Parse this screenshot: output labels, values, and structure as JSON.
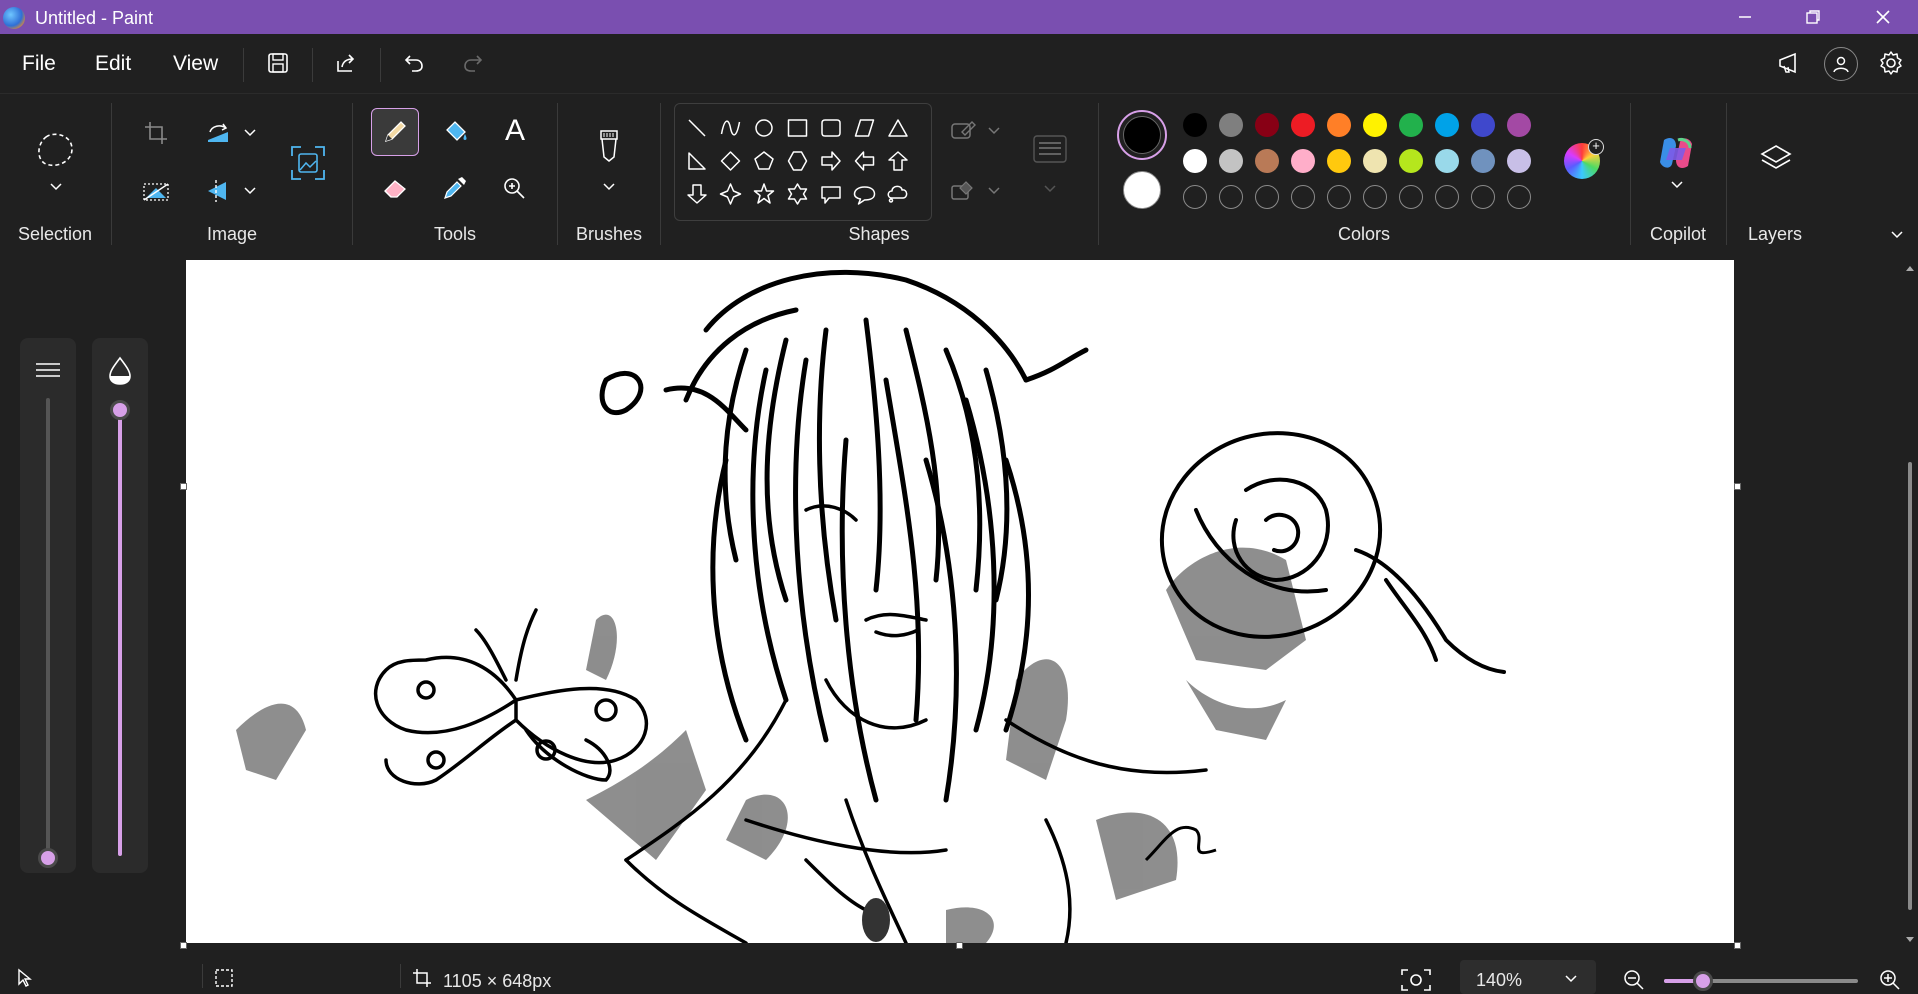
{
  "window": {
    "title": "Untitled - Paint",
    "minimize_glyph": "─",
    "maximize_glyph": "⧉",
    "close_glyph": "✕"
  },
  "menu": {
    "file": "File",
    "edit": "Edit",
    "view": "View"
  },
  "ribbon": {
    "groups": {
      "selection": "Selection",
      "image": "Image",
      "tools": "Tools",
      "brushes": "Brushes",
      "shapes": "Shapes",
      "colors": "Colors",
      "copilot": "Copilot",
      "layers": "Layers"
    },
    "text_tool_glyph": "A",
    "shapes": [
      "line",
      "curve",
      "oval",
      "rectangle",
      "rounded-rectangle",
      "polygon",
      "triangle",
      "right-triangle",
      "diamond",
      "pentagon",
      "hexagon",
      "right-arrow",
      "left-arrow",
      "up-arrow",
      "down-arrow",
      "four-point-star",
      "five-point-star",
      "six-point-star",
      "rounded-callout",
      "oval-callout",
      "cloud-callout"
    ],
    "colors": {
      "primary": "#000000",
      "secondary": "#ffffff",
      "row1": [
        "#000000",
        "#7f7f7f",
        "#880015",
        "#ed1c24",
        "#ff7f27",
        "#fff200",
        "#22b14c",
        "#00a2e8",
        "#3f48cc",
        "#a349a4"
      ],
      "row2": [
        "#ffffff",
        "#c3c3c3",
        "#b97a57",
        "#ffaec9",
        "#ffc90e",
        "#efe4b0",
        "#b5e61d",
        "#99d9ea",
        "#7092be",
        "#c8bfe7"
      ],
      "custom_slots": 10,
      "accent": "#d7a0e8"
    }
  },
  "sliders": {
    "size_level": 0,
    "opacity_level": 1
  },
  "status": {
    "canvas_size": "1105 × 648px",
    "zoom": "140%",
    "zoom_slider_level": 0.2
  }
}
